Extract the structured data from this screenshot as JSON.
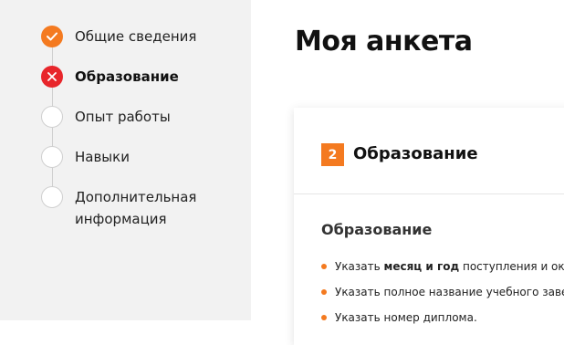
{
  "steps": [
    {
      "label": "Общие сведения",
      "status": "done",
      "icon": "check-icon"
    },
    {
      "label": "Образование",
      "status": "error",
      "icon": "close-icon"
    },
    {
      "label": "Опыт работы",
      "status": "empty",
      "icon": ""
    },
    {
      "label": "Навыки",
      "status": "empty",
      "icon": ""
    },
    {
      "label": "Дополнительная информация",
      "status": "empty",
      "icon": ""
    }
  ],
  "page": {
    "title": "Моя анкета"
  },
  "card": {
    "step_number": "2",
    "title": "Образование",
    "section_title": "Образование",
    "bullets": [
      {
        "prefix": "Указать ",
        "bold": "месяц и год",
        "suffix": " поступления и оконча"
      },
      {
        "prefix": "Указать полное название учебного заведе",
        "bold": "",
        "suffix": ""
      },
      {
        "prefix": "Указать номер диплома.",
        "bold": "",
        "suffix": ""
      }
    ]
  },
  "colors": {
    "accent": "#f47a20",
    "error": "#e8262b",
    "sidebar_bg": "#f2f2f2"
  }
}
